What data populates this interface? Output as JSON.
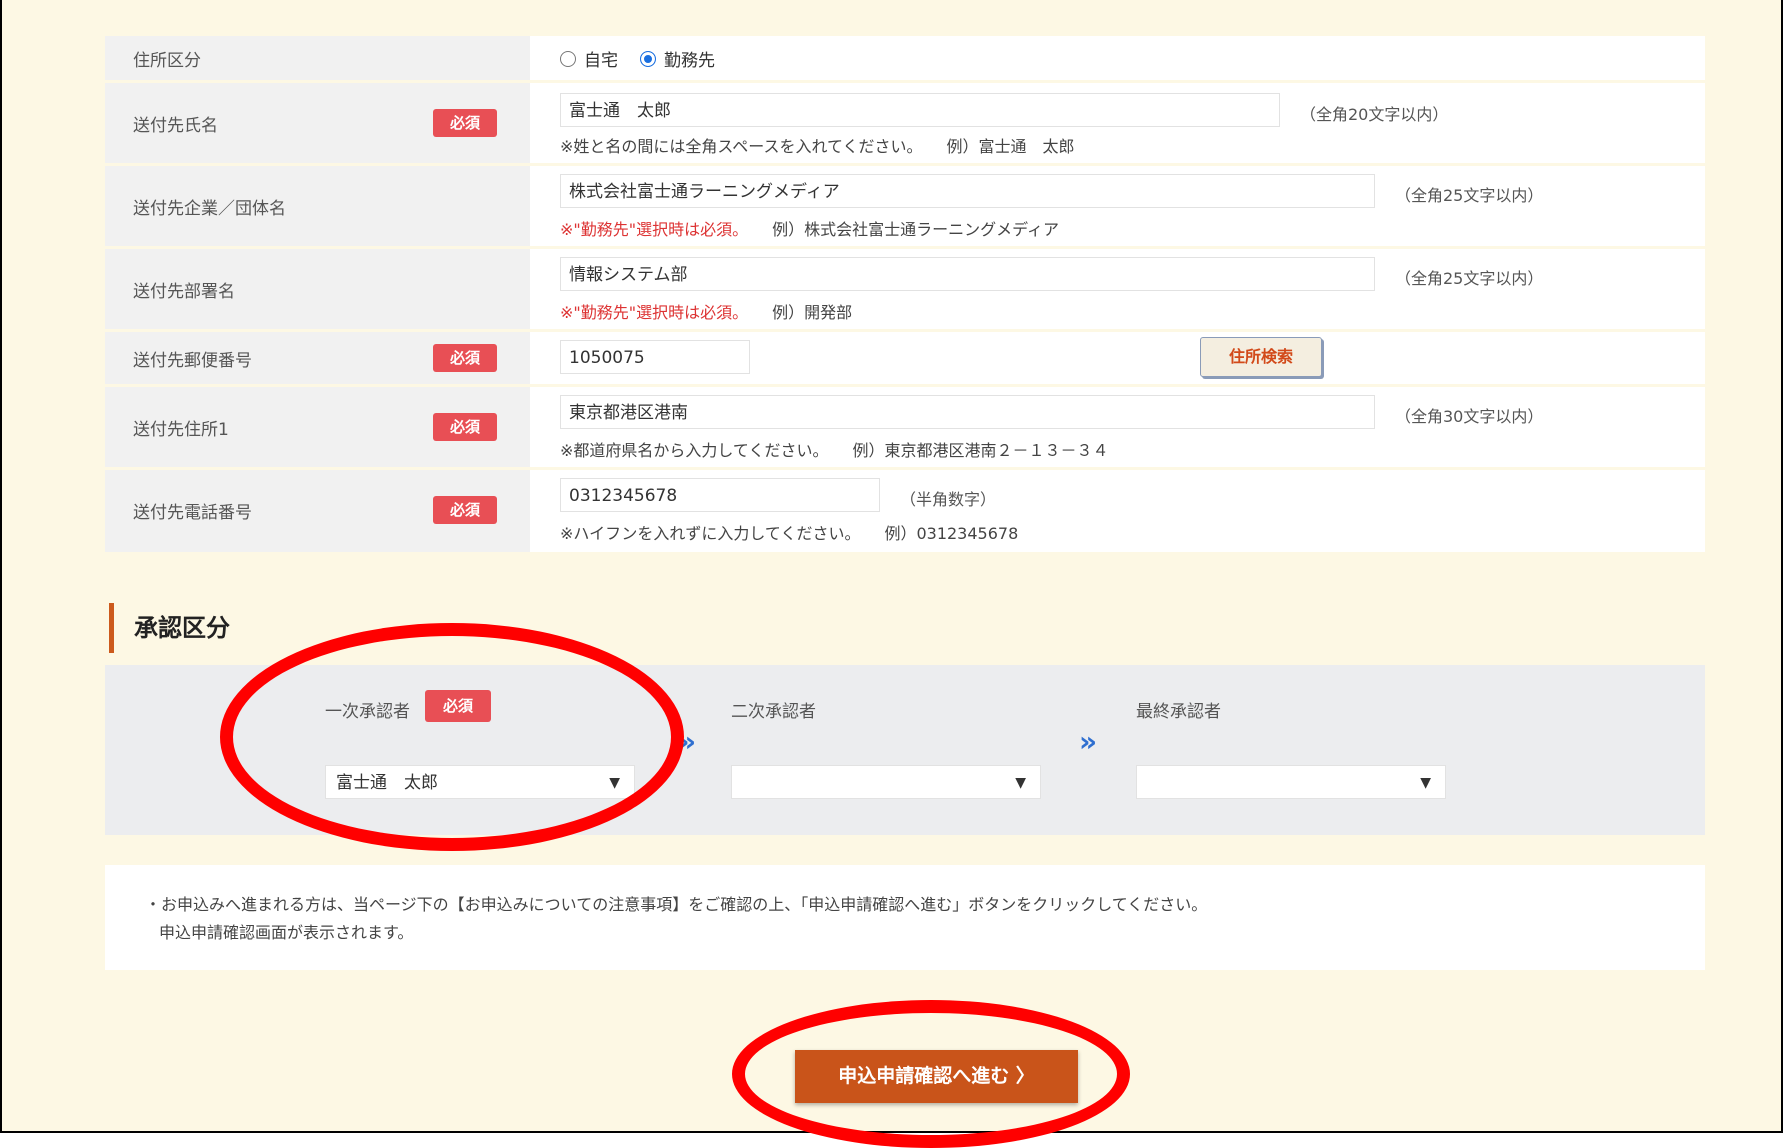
{
  "form": {
    "rows": [
      {
        "label": "住所区分",
        "required": false,
        "radios": [
          {
            "label": "自宅",
            "checked": false
          },
          {
            "label": "勤務先",
            "checked": true
          }
        ]
      },
      {
        "label": "送付先氏名",
        "required": true,
        "value": "富士通　太郎",
        "limit": "（全角20文字以内）",
        "hint": "※姓と名の間には全角スペースを入れてください。",
        "example": "例）富士通　太郎"
      },
      {
        "label": "送付先企業／団体名",
        "required": false,
        "value": "株式会社富士通ラーニングメディア",
        "limit": "（全角25文字以内）",
        "hint": "※\"勤務先\"選択時は必須。",
        "example": "例）株式会社富士通ラーニングメディア"
      },
      {
        "label": "送付先部署名",
        "required": false,
        "value": "情報システム部",
        "limit": "（全角25文字以内）",
        "hint": "※\"勤務先\"選択時は必須。",
        "example": "例）開発部"
      },
      {
        "label": "送付先郵便番号",
        "required": true,
        "value": "1050075",
        "button": "住所検索"
      },
      {
        "label": "送付先住所1",
        "required": true,
        "value": "東京都港区港南",
        "limit": "（全角30文字以内）",
        "hint": "※都道府県名から入力してください。",
        "example": "例）東京都港区港南２－１３－３４"
      },
      {
        "label": "送付先電話番号",
        "required": true,
        "value": "0312345678",
        "limit": "（半角数字）",
        "hint": "※ハイフンを入れずに入力してください。",
        "example": "例）0312345678"
      }
    ],
    "required_badge": "必須"
  },
  "approval": {
    "title": "承認区分",
    "first_label": "一次承認者",
    "first_value": "富士通　太郎",
    "second_label": "二次承認者",
    "second_value": "",
    "final_label": "最終承認者",
    "final_value": ""
  },
  "notice": {
    "line1": "・お申込みへ進まれる方は、当ページ下の【お申込みについての注意事項】をご確認の上、「申込申請確認へ進む」ボタンをクリックしてください。",
    "line2": "申込申請確認画面が表示されます。"
  },
  "submit_label": "申込申請確認へ進む 〉",
  "colors": {
    "background": "#fdf8e4",
    "required": "#e84f55",
    "accent": "#cc5a1c",
    "submit": "#c9541a",
    "highlight": "#ff0000"
  }
}
